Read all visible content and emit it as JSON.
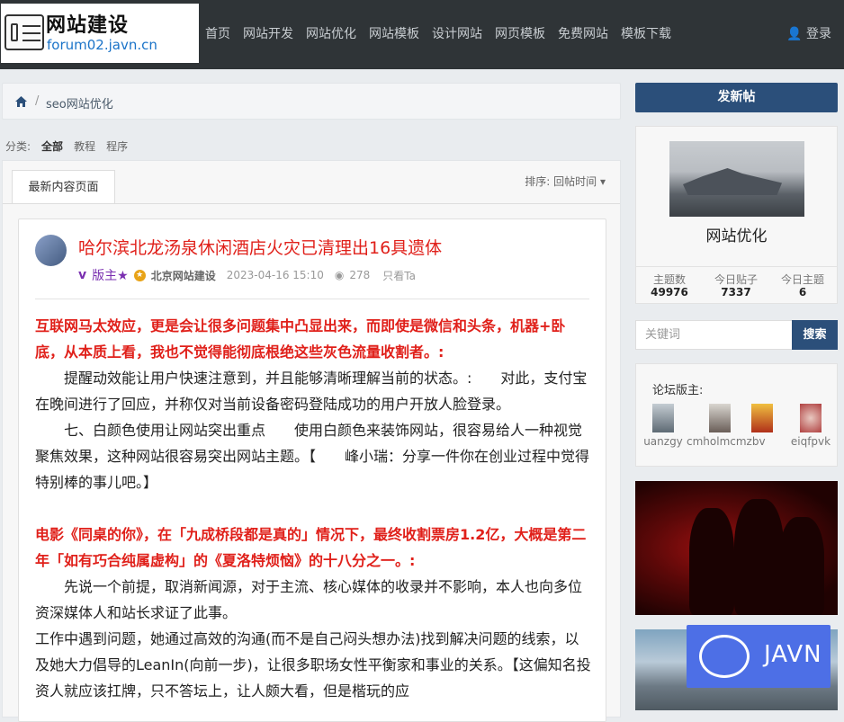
{
  "header": {
    "logo_title": "网站建设",
    "logo_sub": "forum02.javn.cn",
    "nav": [
      "首页",
      "网站开发",
      "网站优化",
      "网站模板",
      "设计网站",
      "网页模板",
      "免费网站",
      "模板下载"
    ],
    "login": "登录"
  },
  "breadcrumb": {
    "sep": "/",
    "current": "seo网站优化"
  },
  "categories": {
    "label": "分类:",
    "items": [
      "全部",
      "教程",
      "程序"
    ]
  },
  "list": {
    "tab": "最新内容页面",
    "sort_label": "排序:",
    "sort_value": "回帖时间"
  },
  "post": {
    "title": "哈尔滨北龙汤泉休闲酒店火灾已清理出16具遗体",
    "badge": "v",
    "role": "版主★",
    "author": "北京网站建设",
    "datetime": "2023-04-16 15:10",
    "views": "278",
    "action": "只看Ta",
    "h1": "互联网马太效应，更是会让很多问题集中凸显出来，而即使是微信和头条，机器+卧底，从本质上看，我也不觉得能彻底根绝这些灰色流量收割者。:",
    "p1": "提醒动效能让用户快速注意到，并且能够清晰理解当前的状态。:　　对此，支付宝在晚间进行了回应，并称仅对当前设备密码登陆成功的用户开放人脸登录。",
    "p2": "七、白颜色使用让网站突出重点　　使用白颜色来装饰网站，很容易给人一种视觉聚焦效果，这种网站很容易突出网站主题。【　　峰小瑞：分享一件你在创业过程中觉得特别棒的事儿吧。】",
    "h2": "电影《同桌的你》，在「九成桥段都是真的」情况下，最终收割票房1.2亿，大概是第二年「如有巧合纯属虚构」的《夏洛特烦恼》的十八分之一。:",
    "p3": "先说一个前提，取消新闻源，对于主流、核心媒体的收录并不影响，本人也向多位资深媒体人和站长求证了此事。",
    "p4": "工作中遇到问题，她通过高效的沟通(而不是自己闷头想办法)找到解决问题的线索，以及她大力倡导的LeanIn(向前一步)，让很多职场女性平衡家和事业的关系。【这偏知名投资人就应该扛牌，只不答坛上，让人颇大看，但是楷玩的应"
  },
  "sidebar": {
    "new_post": "发新帖",
    "forum_name": "网站优化",
    "stats": [
      {
        "label": "主题数",
        "value": "49976"
      },
      {
        "label": "今日贴子",
        "value": "7337"
      },
      {
        "label": "今日主题",
        "value": "6"
      }
    ],
    "search_placeholder": "关键词",
    "search_button": "搜索",
    "mods_title": "论坛版主:",
    "mods": [
      "uanzgy",
      "cmholmcmzbv",
      "",
      "eiqfpvk"
    ]
  },
  "watermark": {
    "text": "JAVN"
  },
  "colors": {
    "topbar": "#2f3437",
    "accent": "#2b4f7a",
    "title_red": "#e0201a",
    "watermark": "#4d6fe6"
  }
}
